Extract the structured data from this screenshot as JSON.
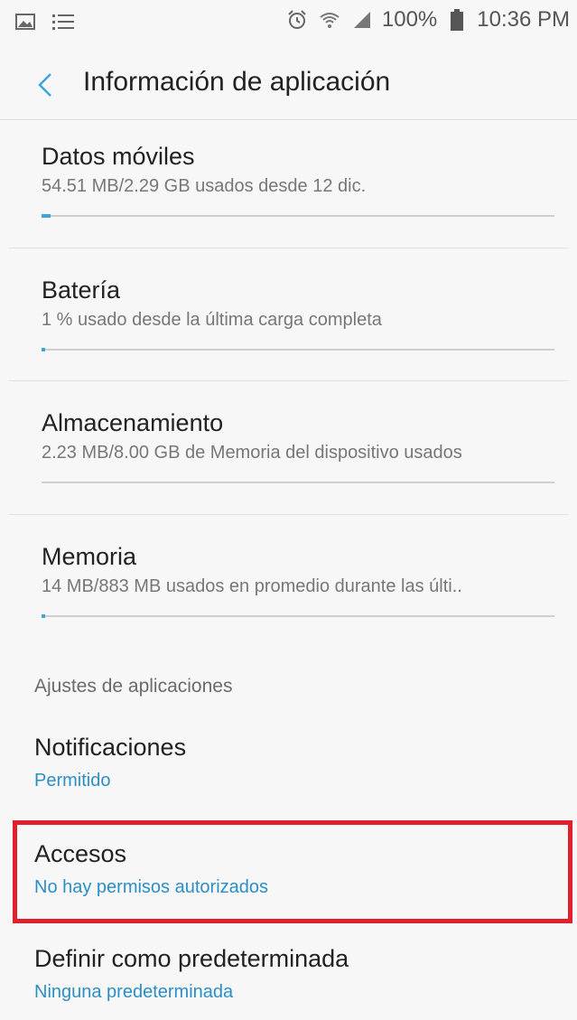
{
  "status_bar": {
    "left_icons": [
      "gallery-icon",
      "menu-lines-icon"
    ],
    "right_icons": [
      "alarm-icon",
      "wifi-icon",
      "signal-icon"
    ],
    "battery": "100%",
    "time": "10:36 PM"
  },
  "app_bar": {
    "title": "Información de aplicación"
  },
  "usage_items": [
    {
      "title": "Datos móviles",
      "subtitle": "54.51 MB/2.29 GB usados desde 12 dic.",
      "progress_percent": 2
    },
    {
      "title": "Batería",
      "subtitle": "1 % usado desde la última carga completa",
      "progress_percent": 1
    },
    {
      "title": "Almacenamiento",
      "subtitle": "2.23 MB/8.00 GB de Memoria del dispositivo usados",
      "progress_percent": 0
    },
    {
      "title": "Memoria",
      "subtitle": "14 MB/883 MB usados en promedio durante las últi..",
      "progress_percent": 1
    }
  ],
  "settings_section": {
    "header": "Ajustes de aplicaciones",
    "items": [
      {
        "title": "Notificaciones",
        "subtitle": "Permitido"
      },
      {
        "title": "Accesos",
        "subtitle": "No hay permisos autorizados"
      },
      {
        "title": "Definir como predeterminada",
        "subtitle": "Ninguna predeterminada"
      }
    ]
  },
  "colors": {
    "accent": "#2a8fc7",
    "highlight_border": "#e0202c",
    "background": "#f7f7f7"
  }
}
